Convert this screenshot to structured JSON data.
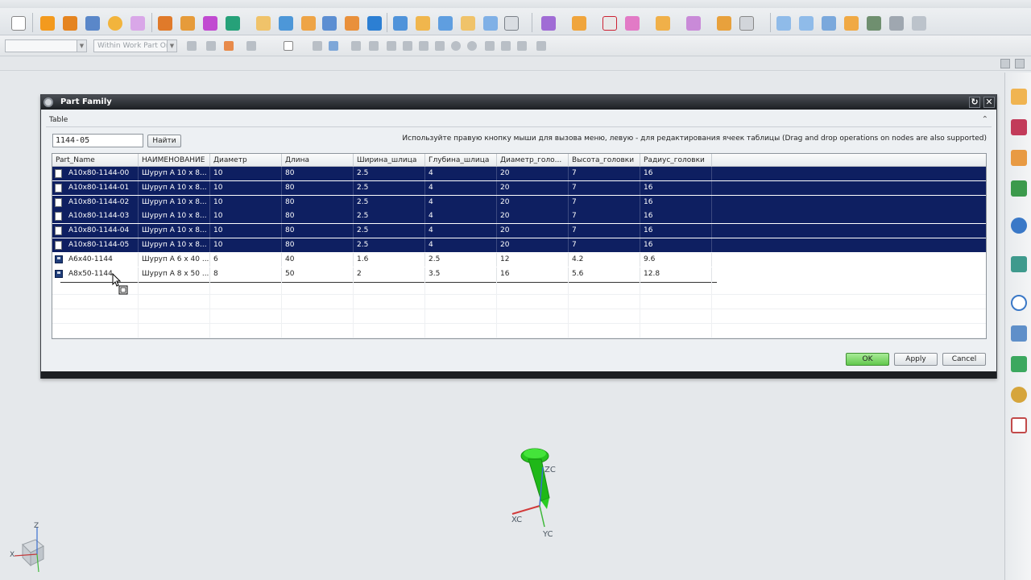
{
  "toolbar": {
    "selection_filter_placeholder": "",
    "scope_combo": "Within Work Part Or"
  },
  "dialog": {
    "title": "Part Family",
    "group_label": "Table",
    "search_value": "1144-05",
    "search_button": "Найти",
    "hint": "Используйте правую кнопку мыши для вызова меню, левую - для редактирования ячеек таблицы (Drag and drop operations on nodes are also supported)",
    "columns": [
      "Part_Name",
      "НАИМЕНОВАНИЕ",
      "Диаметр",
      "Длина",
      "Ширина_шлица",
      "Глубина_шлица",
      "Диаметр_голо...",
      "Высота_головки",
      "Радиус_головки"
    ],
    "rows": [
      {
        "cells": [
          "A10x80-1144-00",
          "Шуруп А 10 х 8...",
          "10",
          "80",
          "2.5",
          "4",
          "20",
          "7",
          "16"
        ],
        "selected": true,
        "icon": "file-icon"
      },
      {
        "cells": [
          "A10x80-1144-01",
          "Шуруп А 10 х 8...",
          "10",
          "80",
          "2.5",
          "4",
          "20",
          "7",
          "16"
        ],
        "selected": true,
        "icon": "file-icon"
      },
      {
        "cells": [
          "A10x80-1144-02",
          "Шуруп А 10 х 8...",
          "10",
          "80",
          "2.5",
          "4",
          "20",
          "7",
          "16"
        ],
        "selected": true,
        "icon": "file-icon"
      },
      {
        "cells": [
          "A10x80-1144-03",
          "Шуруп А 10 х 8...",
          "10",
          "80",
          "2.5",
          "4",
          "20",
          "7",
          "16"
        ],
        "selected": true,
        "icon": "file-icon"
      },
      {
        "cells": [
          "A10x80-1144-04",
          "Шуруп А 10 х 8...",
          "10",
          "80",
          "2.5",
          "4",
          "20",
          "7",
          "16"
        ],
        "selected": true,
        "icon": "file-icon"
      },
      {
        "cells": [
          "A10x80-1144-05",
          "Шуруп А 10 х 8...",
          "10",
          "80",
          "2.5",
          "4",
          "20",
          "7",
          "16"
        ],
        "selected": true,
        "icon": "file-icon"
      },
      {
        "cells": [
          "A6x40-1144",
          "Шуруп А 6 х 40 ...",
          "6",
          "40",
          "1.6",
          "2.5",
          "12",
          "4.2",
          "9.6"
        ],
        "selected": false,
        "icon": "save-icon"
      },
      {
        "cells": [
          "A8x50-1144",
          "Шуруп А 8 х 50 ...",
          "8",
          "50",
          "2",
          "3.5",
          "16",
          "5.6",
          "12.8"
        ],
        "selected": false,
        "icon": "save-icon"
      }
    ],
    "ok_label": "OK",
    "apply_label": "Apply",
    "cancel_label": "Cancel"
  },
  "viewport": {
    "triad_labels": {
      "z": "ZC",
      "x": "XC",
      "y": "YC"
    },
    "corner_triad": {
      "z": "Z",
      "x": "X"
    }
  },
  "colors": {
    "selection": "#0e1f61",
    "ok_button": "#7fd86a",
    "model": "#22c51c"
  }
}
